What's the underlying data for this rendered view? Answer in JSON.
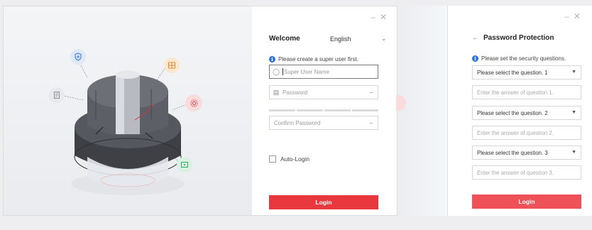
{
  "window_controls": {
    "minimize": "–",
    "close": "✕"
  },
  "login": {
    "welcome": "Welcome",
    "language": "English",
    "info": "Please create a super user first.",
    "username_placeholder": "Super User Name",
    "password_placeholder": "Password",
    "confirm_placeholder": "Confirm Password",
    "auto_login": "Auto-Login",
    "login_button": "Login"
  },
  "protection": {
    "title": "Password Protection",
    "info": "Please set the security questions.",
    "questions": [
      {
        "select": "Please select the question. 1",
        "answer_placeholder": "Enter the answer of question 1."
      },
      {
        "select": "Please select the question. 2",
        "answer_placeholder": "Enter the answer of question 2."
      },
      {
        "select": "Please select the question. 3",
        "answer_placeholder": "Enter the answer of question 3."
      }
    ],
    "login_button": "Login"
  },
  "colors": {
    "accent_red": "#e8383d",
    "info_blue": "#2c6fd8",
    "secondary_red": "#ee5157"
  },
  "icons": [
    "shield-icon",
    "camera-grid-icon",
    "document-icon",
    "gear-icon",
    "play-icon",
    "user-icon",
    "lock-icon",
    "eye-icon",
    "info-icon",
    "dropdown-icon",
    "back-arrow-icon"
  ]
}
